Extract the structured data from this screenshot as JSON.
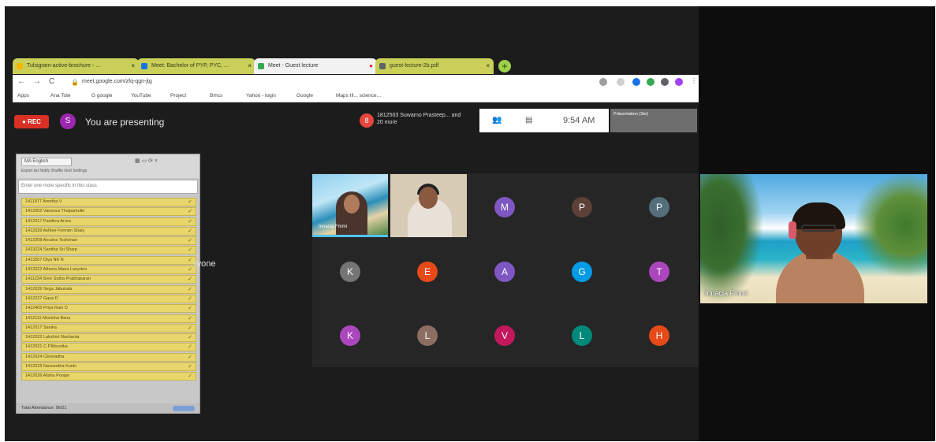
{
  "browser": {
    "tabs": [
      {
        "label": "Tulsigram-active-brochure - ...",
        "active": false,
        "favicon_color": "#f4b400"
      },
      {
        "label": "Meet: Bachelor of PYP, PYC, ...",
        "active": false,
        "favicon_color": "#1a73e8"
      },
      {
        "label": "Meet - Guest lecture",
        "active": true,
        "favicon_color": "#34a853"
      },
      {
        "label": "guest-lecture-2b.pdf",
        "active": false,
        "favicon_color": "#5f6368"
      }
    ],
    "new_tab": "+",
    "url": "meet.google.com/zfq-qgn-jtg",
    "nav": {
      "back": "←",
      "forward": "→",
      "reload": "C"
    },
    "bookmarks": [
      "Apps",
      "Ana Tote",
      "G google",
      "YouTube",
      "Project",
      "Bmcs",
      "Yahoo - login",
      "Google",
      "Maps Ill... science..."
    ]
  },
  "meet": {
    "rec_label": "● REC",
    "presenter_initial": "S",
    "presenting_text": "You are presenting",
    "others_initial": "8",
    "others_text": "1812503 Suwarno Prasteep... and 20 more",
    "clock": "9:54 AM",
    "pip_label": "Präsentation (Sie)",
    "obscured_text": "ryone"
  },
  "attendance": {
    "language": "MA English",
    "subheader": "Export list   Notify   Shuffle   Grid   Settings",
    "search_placeholder": "Enter one more specific in this class",
    "students": [
      "1411977 Amritha V",
      "1412002 Vanessa Thaiparkulle",
      "1412017 Pavithra Arora",
      "1412039 Ashlee Formen Shaiy",
      "1413208 Anusha Toshiman",
      "1413224 Sanitha Sri Sharp",
      "1413207 Diya NK N",
      "1413222 Athena Maria Lanyrton",
      "1411234 Sree Sutha Prabhakaran",
      "1412039 Sega Jabukala",
      "1412227 Gaya D",
      "1412405 Priya Rani D",
      "1412111 Monisha Banu",
      "1412017 Sanika",
      "1412022 Lakshmi Nashanta",
      "1412021 C.P.Mounika",
      "1412024 Cleonaitha",
      "1412015 Naveentha Konki",
      "1412026 Alisha Poojan"
    ],
    "footer": "Total Attendance: 96/21"
  },
  "participants": {
    "video_tiles": [
      {
        "label": "Innacia Fmmi"
      },
      {
        "label": ""
      }
    ],
    "avatars": [
      {
        "initial": "M",
        "color": "#7e57c2"
      },
      {
        "initial": "P",
        "color": "#5d4037"
      },
      {
        "initial": "P",
        "color": "#546e7a"
      },
      {
        "initial": "K",
        "color": "#757575"
      },
      {
        "initial": "E",
        "color": "#e64a19"
      },
      {
        "initial": "A",
        "color": "#7e57c2"
      },
      {
        "initial": "G",
        "color": "#039be5"
      },
      {
        "initial": "T",
        "color": "#ab47bc"
      },
      {
        "initial": "K",
        "color": "#ab47bc"
      },
      {
        "initial": "L",
        "color": "#8d6e63"
      },
      {
        "initial": "V",
        "color": "#c2185b"
      },
      {
        "initial": "L",
        "color": "#00897b"
      },
      {
        "initial": "H",
        "color": "#e64a19"
      }
    ]
  },
  "speaker": {
    "name": "Innacia Fmmi"
  }
}
